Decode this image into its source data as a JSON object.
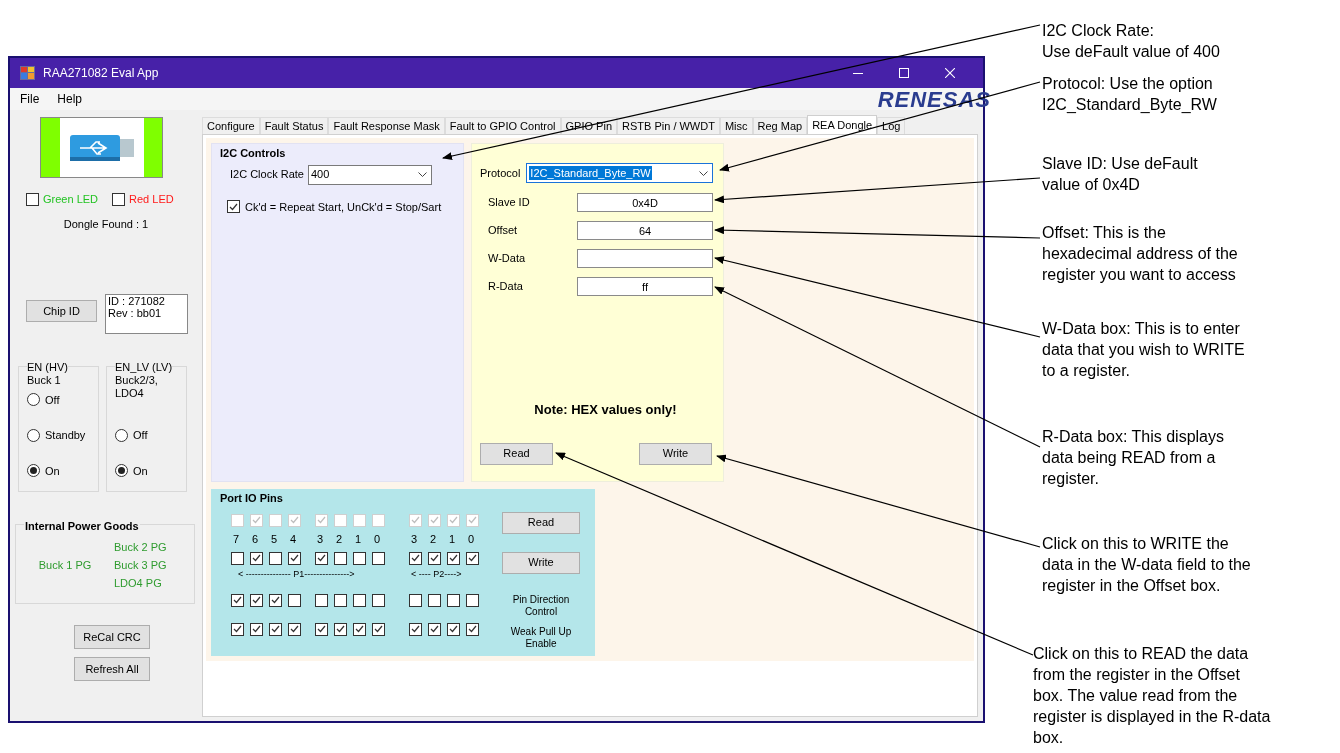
{
  "window": {
    "title": "RAA271082 Eval App"
  },
  "menu": [
    "File",
    "Help"
  ],
  "logo": "RENESAS",
  "left_panel": {
    "leds": [
      {
        "label": "Green LED",
        "checked": false,
        "color": "#22c322"
      },
      {
        "label": "Red LED",
        "checked": false,
        "color": "#ff1a1a"
      }
    ],
    "dongle_status": "Dongle Found : 1",
    "chip_id_button": "Chip ID",
    "chip_info": [
      "ID : 271082",
      "Rev : bb01"
    ],
    "enable_groups": [
      {
        "title_lines": [
          "EN (HV)",
          "Buck 1"
        ],
        "options": [
          {
            "label": "Off",
            "selected": false
          },
          {
            "label": "Standby",
            "selected": false
          },
          {
            "label": "On",
            "selected": true
          }
        ]
      },
      {
        "title_lines": [
          "EN_LV (LV)",
          "Buck2/3,",
          "LDO4"
        ],
        "options": [
          {
            "label": "Off",
            "selected": false
          },
          {
            "label": "On",
            "selected": true
          }
        ]
      }
    ],
    "power_goods": {
      "title": "Internal Power Goods",
      "left": [
        "Buck 1 PG"
      ],
      "right": [
        "Buck 2 PG",
        "Buck 3 PG",
        "LDO4 PG"
      ]
    },
    "buttons": [
      "ReCal CRC",
      "Refresh All"
    ]
  },
  "tabs": [
    {
      "label": "Configure",
      "selected": false
    },
    {
      "label": "Fault Status",
      "selected": false
    },
    {
      "label": "Fault Response Mask",
      "selected": false
    },
    {
      "label": "Fault to GPIO Control",
      "selected": false
    },
    {
      "label": "GPIO Pin",
      "selected": false
    },
    {
      "label": "RSTB Pin / WWDT",
      "selected": false
    },
    {
      "label": "Misc",
      "selected": false
    },
    {
      "label": "Reg Map",
      "selected": false
    },
    {
      "label": "REA Dongle",
      "selected": true
    },
    {
      "label": "Log",
      "selected": false
    }
  ],
  "i2c_controls": {
    "title": "I2C Clock Rate",
    "group_title": "I2C Controls",
    "clock_rate": "400",
    "repeat_start": {
      "label": "Ck'd = Repeat Start, UnCk'd = Stop/Sart",
      "checked": true
    }
  },
  "transfer": {
    "protocol_label": "Protocol",
    "protocol": "I2C_Standard_Byte_RW",
    "protocol_highlighted": true,
    "fields": [
      {
        "label": "Slave ID",
        "value": "0x4D"
      },
      {
        "label": "Offset",
        "value": "64"
      },
      {
        "label": "W-Data"
      },
      {
        "label": "R-Data",
        "value": "ff"
      }
    ],
    "note": "Note:  HEX values only!",
    "buttons": [
      "Read",
      "Write"
    ]
  },
  "port_io": {
    "title": "Port IO Pins",
    "rows": [
      {
        "kind": "checks",
        "disabled": true,
        "p1": [
          false,
          true,
          false,
          true,
          true,
          false,
          false,
          false
        ],
        "p2": [
          true,
          true,
          true,
          true
        ]
      },
      {
        "kind": "labels",
        "p1": [
          "7",
          "6",
          "5",
          "4",
          "3",
          "2",
          "1",
          "0"
        ],
        "p2": [
          "3",
          "2",
          "1",
          "0"
        ]
      },
      {
        "kind": "checks",
        "disabled": false,
        "p1": [
          false,
          true,
          false,
          true,
          true,
          false,
          false,
          false
        ],
        "p2": [
          true,
          true,
          true,
          true
        ]
      },
      {
        "kind": "ports",
        "p1": "< --------------- P1--------------->",
        "p2": "< ---- P2---->"
      },
      {
        "kind": "checks",
        "disabled": false,
        "label": "Pin Direction Control",
        "p1": [
          true,
          true,
          true,
          false,
          false,
          false,
          false,
          false
        ],
        "p2": [
          false,
          false,
          false,
          false
        ]
      },
      {
        "kind": "checks",
        "disabled": false,
        "label": "Weak Pull Up Enable",
        "p1": [
          true,
          true,
          true,
          true,
          true,
          true,
          true,
          true
        ],
        "p2": [
          true,
          true,
          true,
          true
        ]
      }
    ],
    "buttons": [
      "Read",
      "Write"
    ]
  },
  "callouts": [
    "I2C Clock Rate:\nUse deFault value of 400",
    "Protocol:  Use the option\nI2C_Standard_Byte_RW",
    "Slave ID:  Use deFault\nvalue of 0x4D",
    "Offset:  This is the\nhexadecimal address of the\nregister you want to access",
    "W-Data box:  This is to enter\ndata that you wish to WRITE\nto a register.",
    "R-Data box:  This displays\ndata being READ from a\nregister.",
    "Click on this to WRITE the\ndata in the W-data field to the\nregister in the Offset box.",
    "Click on this to READ the data\nfrom the register in the Offset\nbox.  The value read from the\nregister is displayed in the R-data\nbox."
  ]
}
